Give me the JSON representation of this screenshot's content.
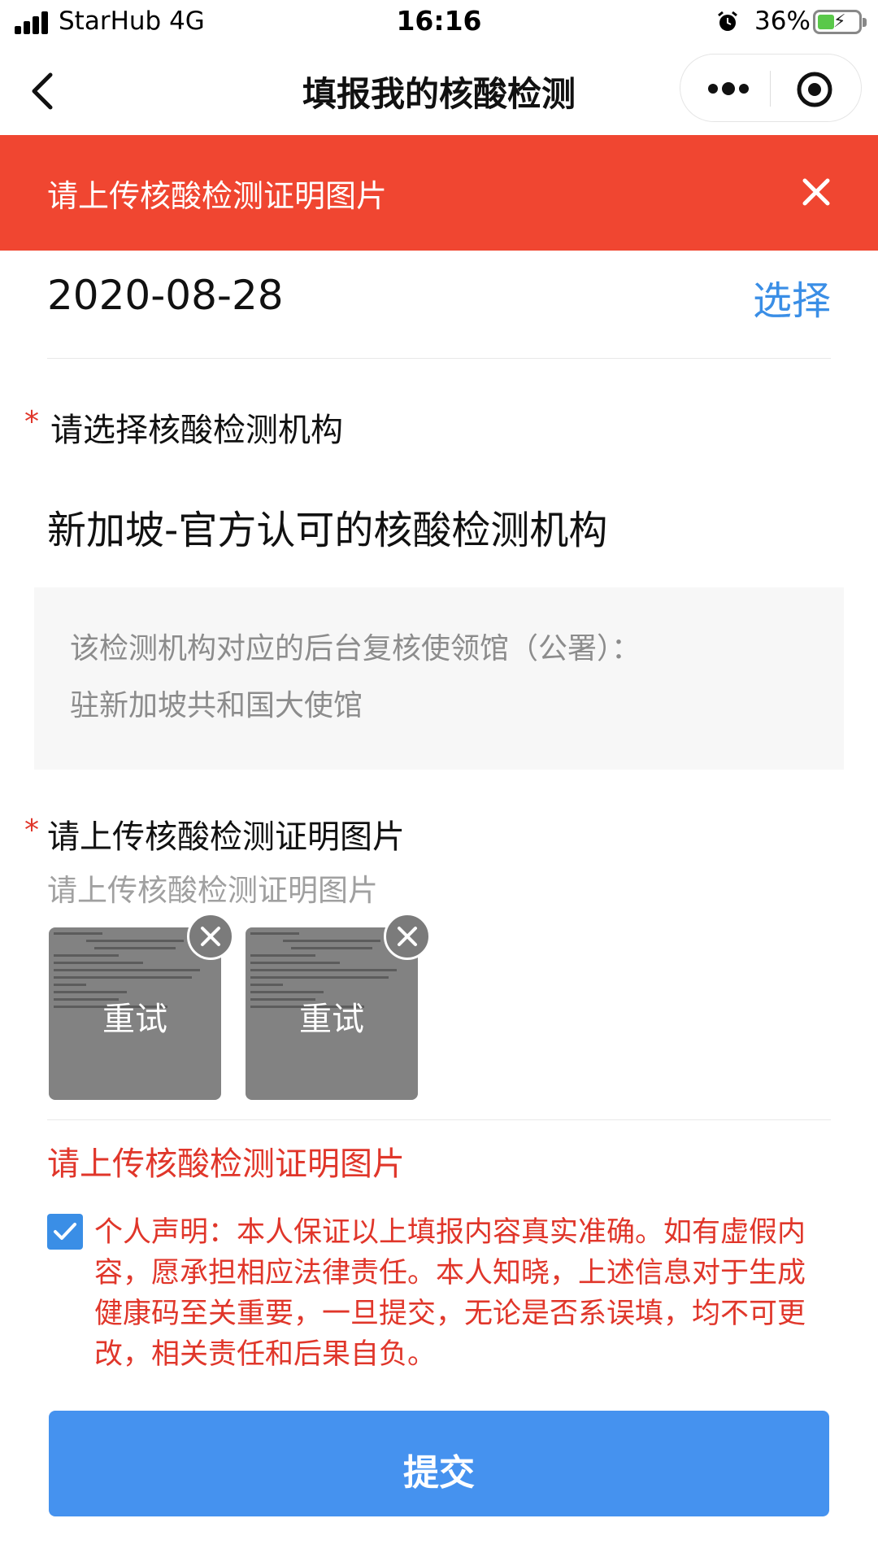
{
  "status_bar": {
    "carrier": "StarHub  4G",
    "time": "16:16",
    "battery": "36%",
    "alarm_icon": "alarm-clock-icon",
    "battery_level": 0.36
  },
  "nav": {
    "title": "填报我的核酸检测",
    "back_icon": "chevron-left-icon",
    "more_icon": "more-dots-icon",
    "close_icon": "target-circle-icon"
  },
  "error_banner": {
    "text": "请上传核酸检测证明图片"
  },
  "date_field": {
    "value": "2020-08-28",
    "action": "选择"
  },
  "institution_field": {
    "required_mark": "*",
    "label": "请选择核酸检测机构",
    "value": "新加坡-官方认可的核酸检测机构",
    "info_lines": [
      "该检测机构对应的后台复核使领馆（公署）：",
      "驻新加坡共和国大使馆"
    ]
  },
  "upload_field": {
    "required_mark": "*",
    "label": "请上传核酸检测证明图片",
    "hint": "请上传核酸检测证明图片",
    "images": [
      {
        "retry_label": "重试"
      },
      {
        "retry_label": "重试"
      }
    ],
    "error": "请上传核酸检测证明图片"
  },
  "declaration": {
    "checked": true,
    "text": "个人声明：本人保证以上填报内容真实准确。如有虚假内容，愿承担相应法律责任。本人知晓，上述信息对于生成健康码至关重要，一旦提交，无论是否系误填，均不可更改，相关责任和后果自负。"
  },
  "submit": {
    "label": "提交"
  },
  "colors": {
    "error_red": "#f04631",
    "accent_blue": "#3a8ee6",
    "submit_blue": "#4592ef"
  }
}
